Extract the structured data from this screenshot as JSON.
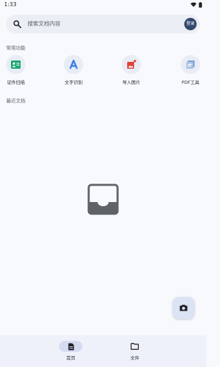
{
  "status_bar": {
    "time": "1:33"
  },
  "search": {
    "placeholder": "搜索文档内容",
    "login_label": "登录"
  },
  "common_features": {
    "title": "常用功能",
    "items": [
      {
        "label": "证件扫描",
        "icon": "id-card-icon",
        "color": "#1aa874"
      },
      {
        "label": "文字识别",
        "icon": "letter-a-icon",
        "color": "#3a7de8"
      },
      {
        "label": "导入图片",
        "icon": "import-image-icon",
        "color": "#e2403a"
      },
      {
        "label": "PDF工具",
        "icon": "pdf-tool-icon",
        "color": "#7aa0d6"
      }
    ]
  },
  "recent_docs": {
    "title": "最近文档",
    "empty_icon": "empty-inbox-icon"
  },
  "fab": {
    "icon": "camera-icon"
  },
  "bottom_nav": {
    "items": [
      {
        "label": "首页",
        "icon": "document-icon",
        "active": true
      },
      {
        "label": "文件",
        "icon": "folder-icon",
        "active": false
      }
    ]
  }
}
